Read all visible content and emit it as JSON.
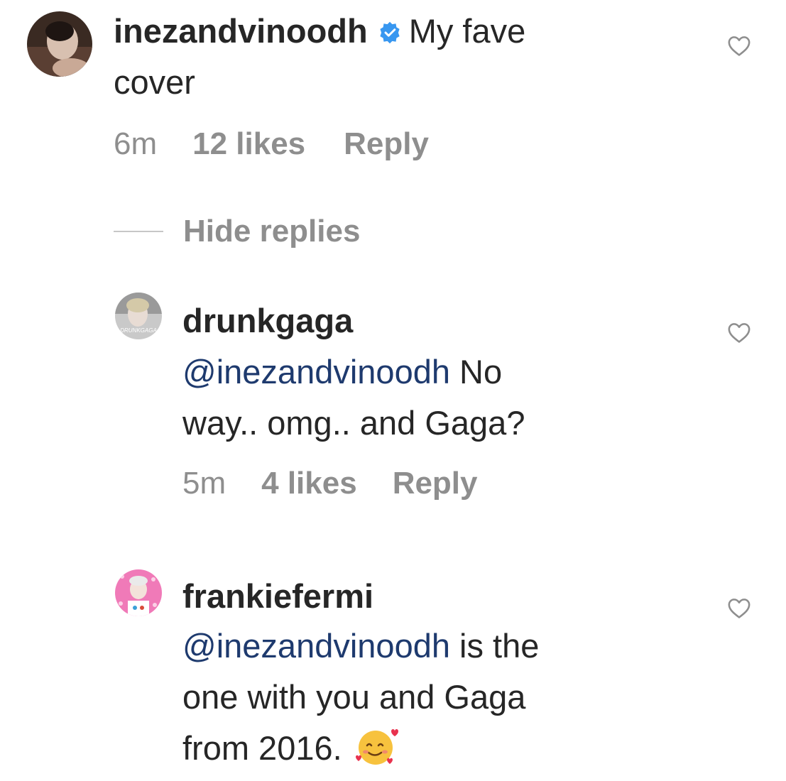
{
  "comments": [
    {
      "username": "inezandvinoodh",
      "verified": true,
      "text": "My fave",
      "text_cont": "cover",
      "time": "6m",
      "likes": "12 likes",
      "reply": "Reply"
    },
    {
      "username": "drunkgaga",
      "avatar_text": "DRUNKGAGA",
      "mention": "@inezandvinoodh",
      "text": " No",
      "text_cont": "way.. omg.. and Gaga?",
      "time": "5m",
      "likes": "4 likes",
      "reply": "Reply"
    },
    {
      "username": "frankiefermi",
      "mention": "@inezandvinoodh",
      "text": " is the",
      "text_cont": "one with you and Gaga",
      "text_cont2": "from 2016. ",
      "emoji": "smiling-face-with-hearts"
    }
  ],
  "hide_replies": "Hide replies",
  "colors": {
    "text": "#262626",
    "meta": "#8e8e8e",
    "mention": "#1e3a6e",
    "verified": "#3897f0"
  }
}
